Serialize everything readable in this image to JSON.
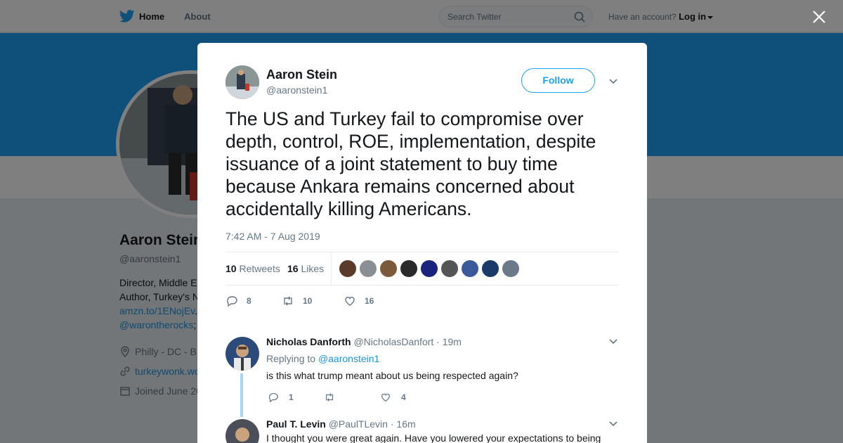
{
  "nav": {
    "home_label": "Home",
    "about_label": "About",
    "search_placeholder": "Search Twitter",
    "account_prompt": "Have an account?",
    "login_label": "Log in"
  },
  "profile": {
    "name": "Aaron Stein",
    "handle": "@aaronstein1",
    "bio_line1": "Director, Middle E",
    "bio_line2": "Author, Turkey's N",
    "bio_link1": "amzn.to/1ENojEv",
    "bio_link1_suffix": ".",
    "bio_link2": "@warontherocks",
    "bio_link2_suffix": ";",
    "location": "Philly - DC - B",
    "website": "turkeywonk.wo",
    "joined": "Joined June 20"
  },
  "tweet": {
    "author_name": "Aaron Stein",
    "author_handle": "@aaronstein1",
    "follow_label": "Follow",
    "text": "The US and Turkey fail to compromise over depth, control, ROE, implementation, despite issuance of a joint statement to buy time because Ankara remains concerned about accidentally killing Americans.",
    "timestamp": "7:42 AM - 7 Aug 2019",
    "retweets_count": "10",
    "retweets_label": "Retweets",
    "likes_count": "16",
    "likes_label": "Likes",
    "reply_count": "8",
    "retweet_action_count": "10",
    "like_action_count": "16",
    "liker_colors": [
      "#5a3a2a",
      "#8a8f95",
      "#7a5a3a",
      "#2a2a2a",
      "#1a237e",
      "#555555",
      "#3a5a9a",
      "#1a3a6a",
      "#6a7a8a"
    ]
  },
  "replies": [
    {
      "name": "Nicholas Danforth",
      "handle": "@NicholasDanfort",
      "time": "· 19m",
      "replying_prefix": "Replying to",
      "replying_to": "@aaronstein1",
      "text": "is this what trump meant about us being respected again?",
      "reply_count": "1",
      "retweet_count": "",
      "like_count": "4"
    },
    {
      "name": "Paul T. Levin",
      "handle": "@PaulTLevin",
      "time": "· 16m",
      "text": "I thought you were great again. Have you lowered your expectations to being"
    }
  ],
  "colors": {
    "accent": "#1da1f2",
    "link": "#1b95e0",
    "muted": "#657786",
    "like_red": "#e0245e"
  }
}
